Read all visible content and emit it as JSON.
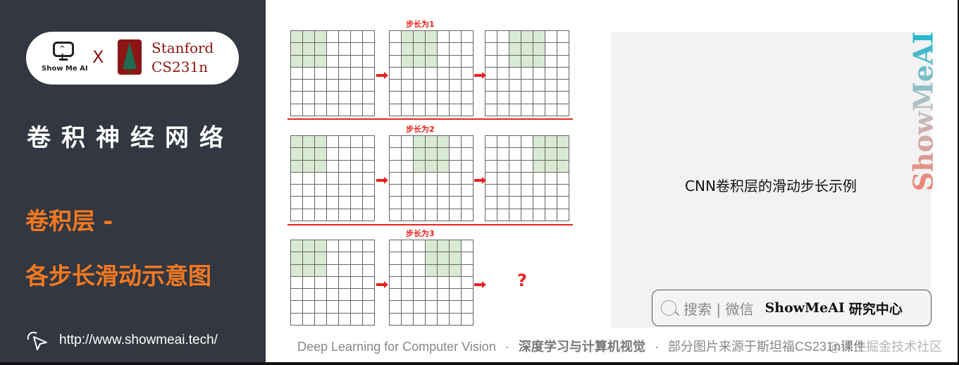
{
  "sidebar": {
    "logo": {
      "showmeai_eyes": "^ I",
      "showmeai_text": "Show Me AI",
      "separator": "X",
      "stanford_line1": "Stanford",
      "stanford_line2": "CS231n"
    },
    "course_title": "卷积神经网络",
    "section_title_line1": "卷积层 -",
    "section_title_line2": "各步长滑动示意图",
    "url": "http://www.showmeai.tech/"
  },
  "diagram": {
    "grid_size": 7,
    "kernel_size": 3,
    "colors": {
      "highlight": "#d9ead3",
      "accent": "#e8231f"
    },
    "rows": [
      {
        "label": "步长为1",
        "stride": 1,
        "panels": [
          {
            "col_start": 0
          },
          {
            "col_start": 1
          },
          {
            "col_start": 2
          }
        ],
        "question": ""
      },
      {
        "label": "步长为2",
        "stride": 2,
        "panels": [
          {
            "col_start": 0
          },
          {
            "col_start": 2
          },
          {
            "col_start": 4
          }
        ],
        "question": ""
      },
      {
        "label": "步长为3",
        "stride": 3,
        "panels": [
          {
            "col_start": 0
          },
          {
            "col_start": 3
          }
        ],
        "question": "?"
      }
    ]
  },
  "caption_panel": {
    "caption": "CNN卷积层的滑动步长示例",
    "brand_vertical": "ShowMeAI",
    "search_hint": "搜索 | 微信",
    "search_brand": "ShowMeAI",
    "search_brand_cn": "研究中心"
  },
  "footer": {
    "en": "Deep Learning for Computer Vision",
    "dot1": "·",
    "cn_bold": "深度学习与计算机视觉",
    "dot2": "·",
    "source": "部分图片来源于斯坦福CS231n课件",
    "watermark": "@稀土掘金技术社区"
  }
}
